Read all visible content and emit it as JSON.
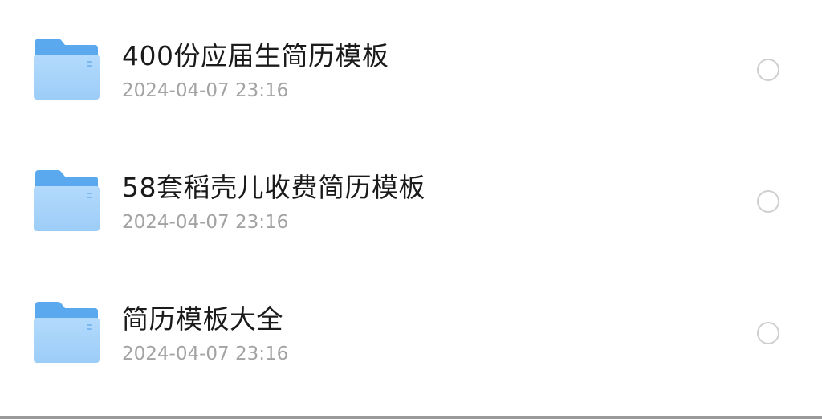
{
  "files": [
    {
      "name": "400份应届生简历模板",
      "modified": "2024-04-07 23:16",
      "icon": "folder-icon",
      "selected": false
    },
    {
      "name": "58套稻壳儿收费简历模板",
      "modified": "2024-04-07 23:16",
      "icon": "folder-icon",
      "selected": false
    },
    {
      "name": "简历模板大全",
      "modified": "2024-04-07 23:16",
      "icon": "folder-icon",
      "selected": false
    }
  ],
  "colors": {
    "folder_back": "#5aa9ef",
    "folder_front": "#a9d4fb",
    "title": "#1a1a1a",
    "date": "#a3a3a3",
    "radio_border": "#cfcfcf"
  }
}
